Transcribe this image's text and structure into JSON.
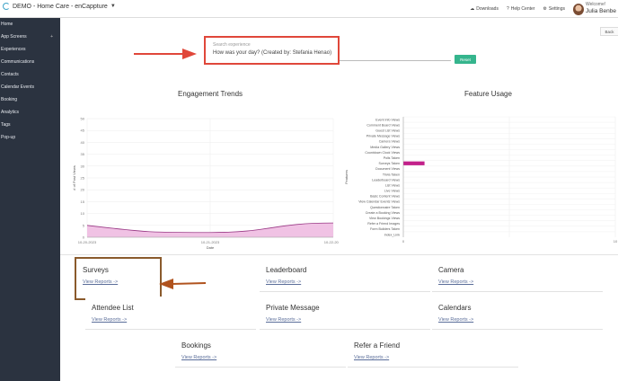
{
  "app": {
    "title": "DEMO - Home Care - enCappture",
    "downloads": "Downloads",
    "help": "Help Center",
    "settings": "Settings",
    "welcome": "Welcome!",
    "user_name": "Julia Benbe"
  },
  "sidebar": {
    "items": [
      {
        "label": "Home"
      },
      {
        "label": "App Screens",
        "expand": "+"
      },
      {
        "label": "Experiences"
      },
      {
        "label": "Communications"
      },
      {
        "label": "Contacts"
      },
      {
        "label": "Calendar Events"
      },
      {
        "label": "Booking"
      },
      {
        "label": "Analytics"
      },
      {
        "label": "Tags"
      },
      {
        "label": "Pop-up"
      }
    ]
  },
  "search": {
    "placeholder": "Search experience",
    "value": "How was your day? (Created by: Stefania Henao)",
    "reset_label": "Reset"
  },
  "back_label": "Back",
  "colors": {
    "highlight_red": "#e0473a",
    "highlight_brown": "#8a5a2c",
    "reset_green": "#35b58d",
    "series_pink": "#c2208a",
    "sidebar_bg": "#2b3340"
  },
  "chart_data": [
    {
      "type": "area",
      "title": "Engagement Trends",
      "xlabel": "Date",
      "ylabel": "# of Post Views",
      "ylim": [
        0,
        50
      ],
      "yticks": [
        0,
        5,
        10,
        15,
        20,
        25,
        30,
        35,
        40,
        45,
        50
      ],
      "x": [
        "10-20-2023",
        "10-21-2023",
        "10-22-2023"
      ],
      "values": [
        5,
        2,
        6
      ],
      "grid": true
    },
    {
      "type": "bar",
      "orientation": "horizontal",
      "title": "Feature Usage",
      "ylabel": "Features",
      "categories": [
        "Event Info Views",
        "Comment Board Views",
        "Guest List Views",
        "Private Message Views",
        "Camera Views",
        "Media Gallery Views",
        "Countdown Clock Views",
        "Polls Taken",
        "Surveys Taken",
        "Document Views",
        "Trivia Taken",
        "Leaderboard Views",
        "List Views",
        "Live Views",
        "Basic Content Views",
        "View Calendar Events Views",
        "Questionnaire Taken",
        "Create a Booking Views",
        "View Bookings Views",
        "Refer a Friend Images",
        "Form Builders Taken",
        "index_Link"
      ],
      "values": [
        0,
        0,
        0,
        0,
        0,
        0,
        0,
        0,
        1,
        0,
        0,
        0,
        0,
        0,
        0,
        0,
        0,
        0,
        0,
        0,
        0,
        0
      ],
      "xlim": [
        0,
        10
      ],
      "xticks": [
        0,
        10
      ],
      "grid": true
    }
  ],
  "cards": [
    {
      "title": "Surveys",
      "link": "View Reports ->"
    },
    {
      "title": "Leaderboard",
      "link": "View Reports ->"
    },
    {
      "title": "Camera",
      "link": "View Reports ->"
    },
    {
      "title": "Attendee List",
      "link": "View Reports ->"
    },
    {
      "title": "Private Message",
      "link": "View Reports ->"
    },
    {
      "title": "Calendars",
      "link": "View Reports ->"
    },
    {
      "title": "Bookings",
      "link": "View Reports ->"
    },
    {
      "title": "Refer a Friend",
      "link": "View Reports ->"
    }
  ]
}
